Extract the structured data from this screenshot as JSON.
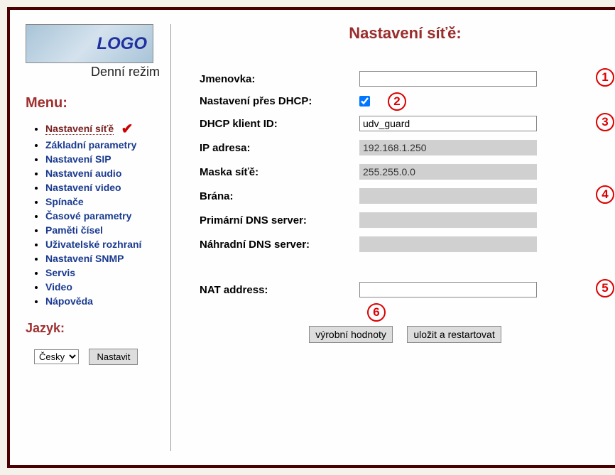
{
  "logo_text": "LOGO",
  "mode_label": "Denní režim",
  "menu": {
    "heading": "Menu:",
    "items": [
      {
        "label": "Nastavení síťě",
        "active": true
      },
      {
        "label": "Základní parametry"
      },
      {
        "label": "Nastavení SIP"
      },
      {
        "label": "Nastavení audio"
      },
      {
        "label": "Nastavení video"
      },
      {
        "label": "Spínače"
      },
      {
        "label": "Časové parametry"
      },
      {
        "label": "Paměti čísel"
      },
      {
        "label": "Uživatelské rozhraní"
      },
      {
        "label": "Nastavení SNMP"
      },
      {
        "label": "Servis"
      },
      {
        "label": "Video"
      },
      {
        "label": "Nápověda"
      }
    ]
  },
  "language": {
    "heading": "Jazyk:",
    "selected": "Česky",
    "button": "Nastavit"
  },
  "page": {
    "title": "Nastavení síťě:",
    "labels": {
      "nametag": "Jmenovka:",
      "dhcp": "Nastavení přes DHCP:",
      "dhcp_client_id": "DHCP klient ID:",
      "ip": "IP adresa:",
      "mask": "Maska síťě:",
      "gateway": "Brána:",
      "dns1": "Primární DNS server:",
      "dns2": "Náhradní DNS server:",
      "nat": "NAT address:"
    },
    "values": {
      "nametag": "",
      "dhcp_checked": true,
      "dhcp_client_id": "udv_guard",
      "ip": "192.168.1.250",
      "mask": "255.255.0.0",
      "gateway": "",
      "dns1": "",
      "dns2": "",
      "nat": ""
    },
    "buttons": {
      "defaults": "výrobní hodnoty",
      "save": "uložit a restartovat"
    },
    "annotations": {
      "n1": "1",
      "n2": "2",
      "n3": "3",
      "n4": "4",
      "n5": "5",
      "n6": "6"
    }
  }
}
